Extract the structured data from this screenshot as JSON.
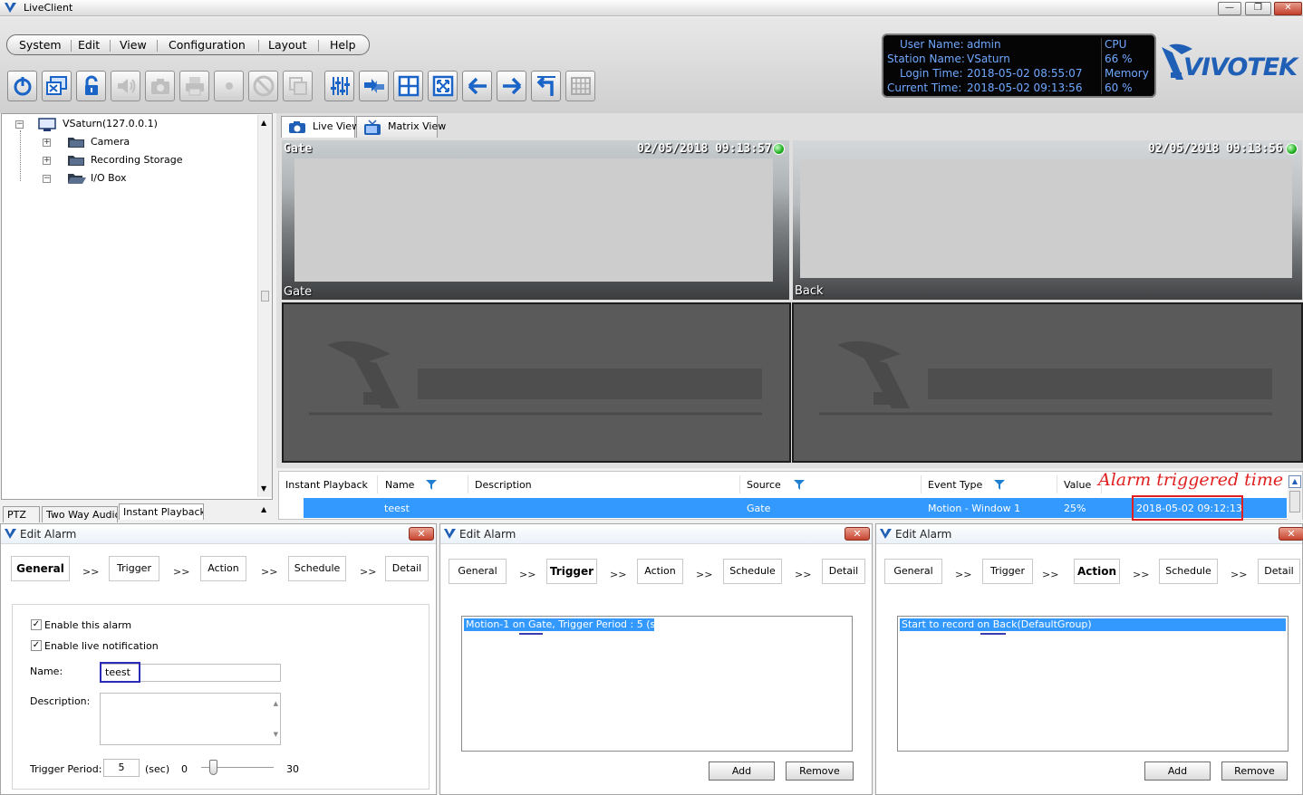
{
  "window": {
    "title": "LiveClient",
    "min": "—",
    "max": "❐",
    "close": "✕"
  },
  "menu": [
    "System",
    "Edit",
    "View",
    "Configuration",
    "Layout",
    "Help"
  ],
  "toolbar_icons": [
    "power-icon",
    "logout-station-icon",
    "lock-icon",
    "audio-icon",
    "snapshot-icon",
    "print-icon",
    "record-icon",
    "stop-icon",
    "playback-icon",
    "equalizer-icon",
    "switch-view-icon",
    "grid-layout-icon",
    "fullscreen-icon",
    "previous-icon",
    "next-icon",
    "return-icon",
    "matrix-icon"
  ],
  "status": {
    "user_label": "User Name:",
    "user": "admin",
    "station_label": "Station Name:",
    "station": "VSaturn",
    "login_label": "Login Time:",
    "login": "2018-05-02 08:55:07",
    "current_label": "Current Time:",
    "current": "2018-05-02 09:13:56",
    "cpu_label": "CPU",
    "cpu": "66 %",
    "mem_label": "Memory",
    "mem": "60 %"
  },
  "logo_text": "VIVOTEK",
  "tree": {
    "root": "VSaturn(127.0.0.1)",
    "children": [
      "Camera",
      "Recording Storage",
      "I/O Box"
    ]
  },
  "left_tabs": [
    "PTZ",
    "Two Way Audio",
    "Instant Playback"
  ],
  "view_tabs": [
    "Live View",
    "Matrix View"
  ],
  "cameras": [
    {
      "name": "Gate",
      "timestamp": "02/05/2018 09:13:57",
      "bottom_label": "Gate"
    },
    {
      "name": "Back",
      "timestamp": "02/05/2018 09:13:56",
      "bottom_label": "Back"
    }
  ],
  "alarm_list": {
    "columns": [
      "Instant Playback",
      "Name",
      "Description",
      "Source",
      "Event Type",
      "Value"
    ],
    "row": {
      "name": "teest",
      "description": "",
      "source": "Gate",
      "event_type": "Motion - Window 1",
      "value": "25%",
      "time": "2018-05-02 09:12:13"
    }
  },
  "annotation": "Alarm triggered time",
  "dialogs": [
    {
      "title": "Edit Alarm",
      "steps": [
        "General",
        "Trigger",
        "Action",
        "Schedule",
        "Detail"
      ],
      "active": "General",
      "enable_alarm": "Enable this alarm",
      "enable_live": "Enable live notification",
      "name_label": "Name:",
      "name_value": "teest",
      "desc_label": "Description:",
      "trigger_label": "Trigger Period:",
      "trigger_value": "5",
      "unit": "(sec)",
      "slider_min": "0",
      "slider_max": "30",
      "slider_value": 5
    },
    {
      "title": "Edit Alarm",
      "steps": [
        "General",
        "Trigger",
        "Action",
        "Schedule",
        "Detail"
      ],
      "active": "Trigger",
      "list_item": "Motion-1 on Gate, Trigger Period : 5 (sec)",
      "add": "Add",
      "remove": "Remove"
    },
    {
      "title": "Edit Alarm",
      "steps": [
        "General",
        "Trigger",
        "Action",
        "Schedule",
        "Detail"
      ],
      "active": "Action",
      "list_item": "Start to record on Back(DefaultGroup)",
      "add": "Add",
      "remove": "Remove"
    }
  ],
  "step_arrow": ">>",
  "colors": {
    "selection": "#3399ff",
    "annotation": "#e02020",
    "status_text": "#6fa8ff",
    "name_highlight": "#2b2bb8"
  }
}
